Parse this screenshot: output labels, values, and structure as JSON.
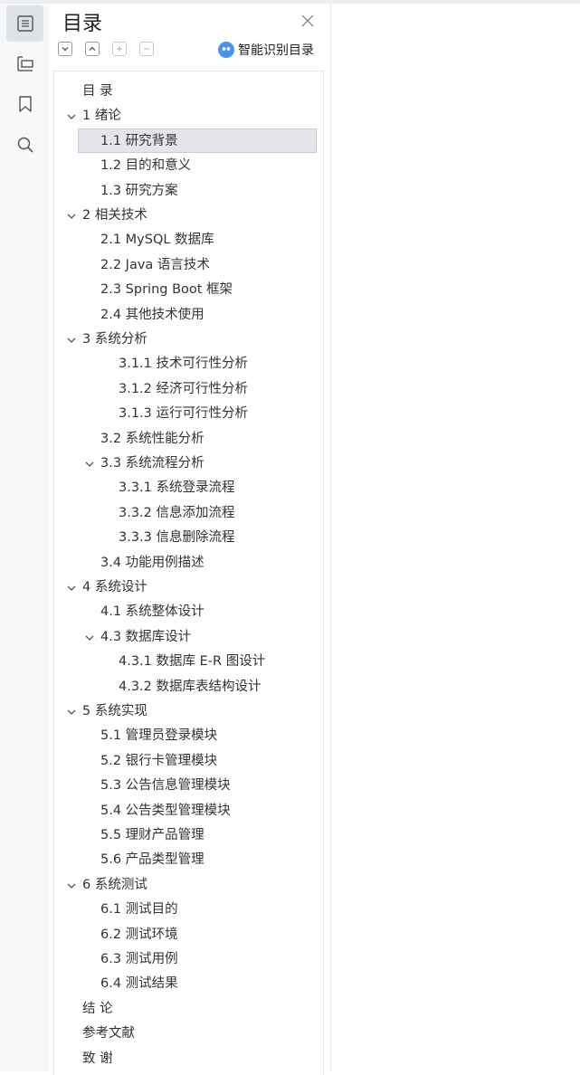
{
  "panel": {
    "title": "目录",
    "smart_label": "智能识别目录",
    "icons": [
      "toc-icon",
      "outline-icon",
      "bookmark-icon",
      "search-icon"
    ]
  },
  "toc": [
    {
      "text": "目  录",
      "level": 0,
      "chevron": false
    },
    {
      "text": "1  绪论",
      "level": 0,
      "chevron": true
    },
    {
      "text": "1.1  研究背景",
      "level": 1,
      "chevron": false,
      "selected": true
    },
    {
      "text": "1.2 目的和意义",
      "level": 1,
      "chevron": false
    },
    {
      "text": "1.3  研究方案",
      "level": 1,
      "chevron": false
    },
    {
      "text": "2  相关技术",
      "level": 0,
      "chevron": true
    },
    {
      "text": "2.1 MySQL 数据库",
      "level": 1,
      "chevron": false
    },
    {
      "text": "2.2 Java 语言技术",
      "level": 1,
      "chevron": false
    },
    {
      "text": "2.3 Spring Boot 框架",
      "level": 1,
      "chevron": false
    },
    {
      "text": "2.4  其他技术使用",
      "level": 1,
      "chevron": false
    },
    {
      "text": "3  系统分析",
      "level": 0,
      "chevron": true
    },
    {
      "text": "3.1.1  技术可行性分析",
      "level": 2,
      "chevron": false
    },
    {
      "text": "3.1.2  经济可行性分析",
      "level": 2,
      "chevron": false
    },
    {
      "text": "3.1.3  运行可行性分析",
      "level": 2,
      "chevron": false
    },
    {
      "text": "3.2 系统性能分析",
      "level": 1,
      "chevron": false
    },
    {
      "text": "3.3 系统流程分析",
      "level": 1,
      "chevron": true
    },
    {
      "text": "3.3.1 系统登录流程",
      "level": 2,
      "chevron": false
    },
    {
      "text": "3.3.2 信息添加流程",
      "level": 2,
      "chevron": false
    },
    {
      "text": "3.3.3 信息删除流程",
      "level": 2,
      "chevron": false
    },
    {
      "text": "3.4  功能用例描述",
      "level": 1,
      "chevron": false
    },
    {
      "text": "4  系统设计",
      "level": 0,
      "chevron": true
    },
    {
      "text": "4.1 系统整体设计",
      "level": 1,
      "chevron": false
    },
    {
      "text": "4.3 数据库设计",
      "level": 1,
      "chevron": true
    },
    {
      "text": "4.3.1 数据库 E-R 图设计",
      "level": 2,
      "chevron": false
    },
    {
      "text": "4.3.2  数据库表结构设计",
      "level": 2,
      "chevron": false
    },
    {
      "text": "5  系统实现",
      "level": 0,
      "chevron": true
    },
    {
      "text": "5.1 管理员登录模块",
      "level": 1,
      "chevron": false
    },
    {
      "text": "5.2  银行卡管理模块",
      "level": 1,
      "chevron": false
    },
    {
      "text": "5.3  公告信息管理模块",
      "level": 1,
      "chevron": false
    },
    {
      "text": "5.4 公告类型管理模块",
      "level": 1,
      "chevron": false
    },
    {
      "text": "5.5  理财产品管理",
      "level": 1,
      "chevron": false
    },
    {
      "text": "5.6  产品类型管理",
      "level": 1,
      "chevron": false
    },
    {
      "text": "6 系统测试",
      "level": 0,
      "chevron": true
    },
    {
      "text": "6.1 测试目的",
      "level": 1,
      "chevron": false
    },
    {
      "text": "6.2 测试环境",
      "level": 1,
      "chevron": false
    },
    {
      "text": "6.3 测试用例",
      "level": 1,
      "chevron": false
    },
    {
      "text": "6.4 测试结果",
      "level": 1,
      "chevron": false
    },
    {
      "text": "结    论",
      "level": 0,
      "chevron": false
    },
    {
      "text": "参考文献",
      "level": 0,
      "chevron": false
    },
    {
      "text": "致    谢",
      "level": 0,
      "chevron": false
    }
  ]
}
